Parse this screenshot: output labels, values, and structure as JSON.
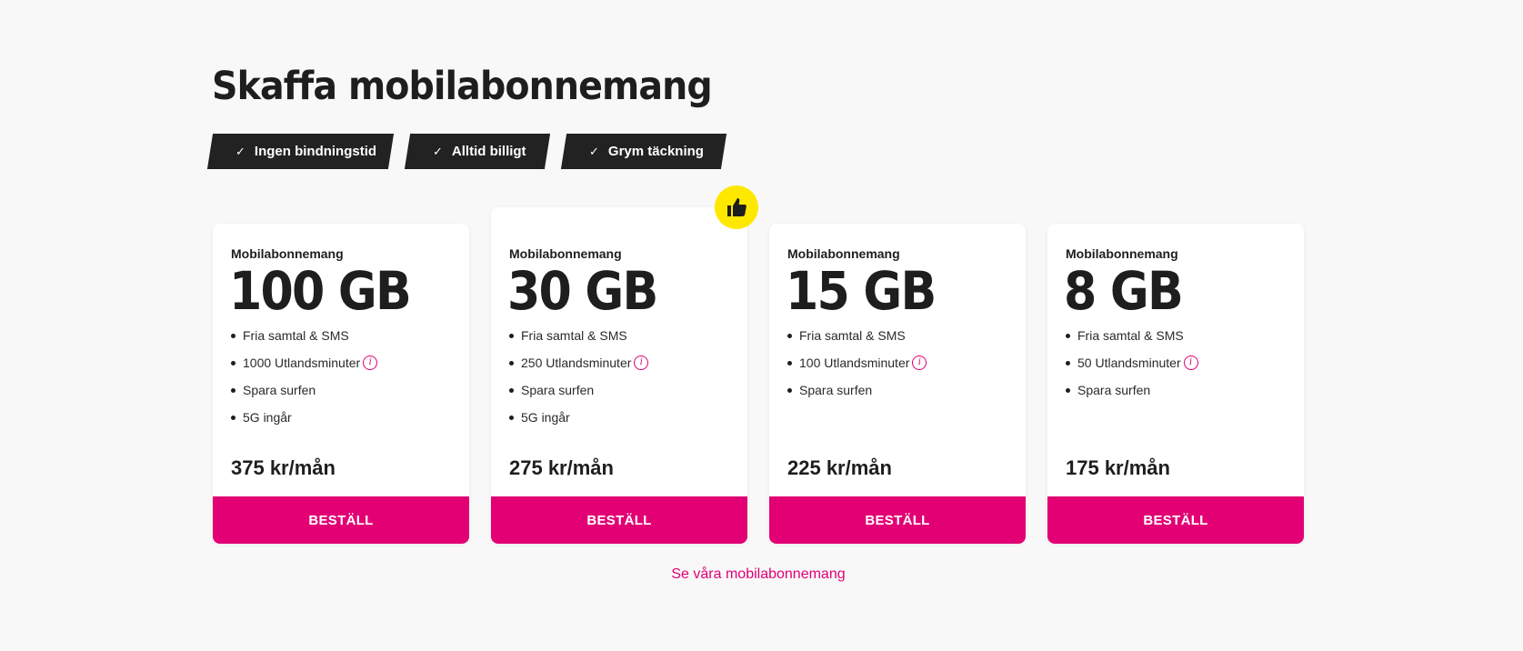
{
  "header": {
    "title": "Skaffa mobilabonnemang"
  },
  "usps": [
    {
      "label": "Ingen bindningstid"
    },
    {
      "label": "Alltid billigt"
    },
    {
      "label": "Grym täckning"
    }
  ],
  "usp_check_glyph": "✓",
  "badge": {
    "icon": "thumbs-up-icon",
    "color": "#ffe800"
  },
  "plans": [
    {
      "label": "Mobilabonnemang",
      "data": "100 GB",
      "features": [
        "Fria samtal & SMS",
        "1000 Utlandsminuter",
        "Spara surfen",
        "5G ingår"
      ],
      "price": "375 kr/mån",
      "button": "BESTÄLL"
    },
    {
      "label": "Mobilabonnemang",
      "data": "30 GB",
      "features": [
        "Fria samtal & SMS",
        "250 Utlandsminuter",
        "Spara surfen",
        "5G ingår"
      ],
      "price": "275 kr/mån",
      "button": "BESTÄLL"
    },
    {
      "label": "Mobilabonnemang",
      "data": "15 GB",
      "features": [
        "Fria samtal & SMS",
        "100 Utlandsminuter",
        "Spara surfen"
      ],
      "price": "225 kr/mån",
      "button": "BESTÄLL"
    },
    {
      "label": "Mobilabonnemang",
      "data": "8 GB",
      "features": [
        "Fria samtal & SMS",
        "50 Utlandsminuter",
        "Spara surfen"
      ],
      "price": "175 kr/mån",
      "button": "BESTÄLL"
    }
  ],
  "info_glyph": "i",
  "link": {
    "label": "Se våra mobilabonnemang"
  },
  "colors": {
    "brand": "#e20074",
    "dark": "#222222",
    "background": "#f8f8f8"
  }
}
